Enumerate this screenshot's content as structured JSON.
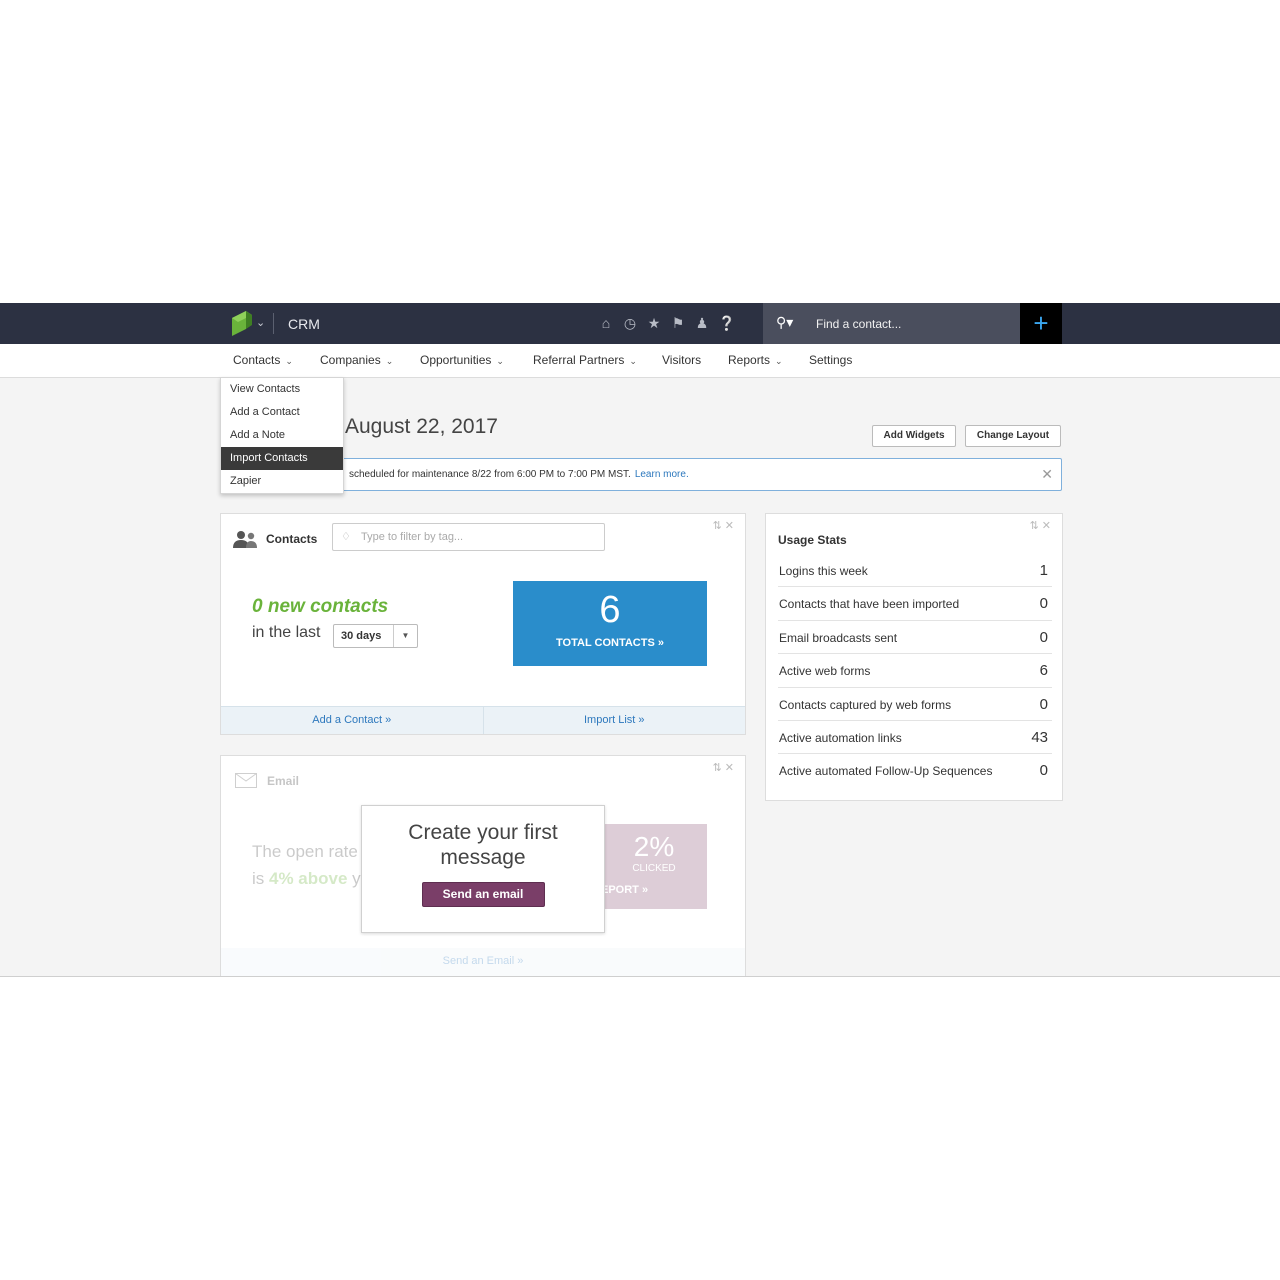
{
  "topbar": {
    "app_title": "CRM",
    "icons": [
      "home-icon",
      "clock-icon",
      "star-icon",
      "tags-icon",
      "person-icon",
      "help-icon"
    ],
    "search_placeholder": "Find a contact...",
    "plus_label": "+"
  },
  "nav": {
    "items": [
      {
        "label": "Contacts",
        "has_menu": true
      },
      {
        "label": "Companies",
        "has_menu": true
      },
      {
        "label": "Opportunities",
        "has_menu": true
      },
      {
        "label": "Referral Partners",
        "has_menu": true
      },
      {
        "label": "Visitors",
        "has_menu": false
      },
      {
        "label": "Reports",
        "has_menu": true
      },
      {
        "label": "Settings",
        "has_menu": false
      }
    ]
  },
  "contacts_menu": {
    "items": [
      "View Contacts",
      "Add a Contact",
      "Add a Note",
      "Import Contacts",
      "Zapier"
    ],
    "active": "Import Contacts"
  },
  "dashboard": {
    "date_title": "August 22, 2017",
    "add_widgets": "Add Widgets",
    "change_layout": "Change Layout"
  },
  "notice": {
    "text": "scheduled for maintenance 8/22 from 6:00 PM to 7:00 PM MST.",
    "link": "Learn more."
  },
  "contacts_widget": {
    "title": "Contacts",
    "filter_placeholder": "Type to filter by tag...",
    "new_contacts": "0 new contacts",
    "in_the_last": "in the last",
    "period": "30 days",
    "total_number": "6",
    "total_label": "TOTAL CONTACTS »",
    "footer_add": "Add a Contact »",
    "footer_import": "Import List »"
  },
  "email_widget": {
    "title": "Email",
    "open_rate_line1": "The open rate",
    "open_rate_prefix": "is ",
    "open_rate_green": "4% above",
    "open_rate_suffix": " y",
    "clicked_value": "2%",
    "clicked_label": "CLICKED",
    "report_label": "EPORT »",
    "footer": "Send an Email »",
    "cta_title": "Create your first message",
    "cta_button": "Send an email"
  },
  "usage_stats": {
    "title": "Usage Stats",
    "rows": [
      {
        "label": "Logins this week",
        "value": "1"
      },
      {
        "label": "Contacts that have been imported",
        "value": "0"
      },
      {
        "label": "Email broadcasts sent",
        "value": "0"
      },
      {
        "label": "Active web forms",
        "value": "6"
      },
      {
        "label": "Contacts captured by web forms",
        "value": "0"
      },
      {
        "label": "Active automation links",
        "value": "43"
      },
      {
        "label": "Active automated Follow-Up Sequences",
        "value": "0"
      }
    ]
  },
  "colors": {
    "topbar": "#2c3142",
    "accent_blue": "#2a8dcb",
    "brand_green": "#6ab33b",
    "email_purple": "#7a3e68"
  }
}
